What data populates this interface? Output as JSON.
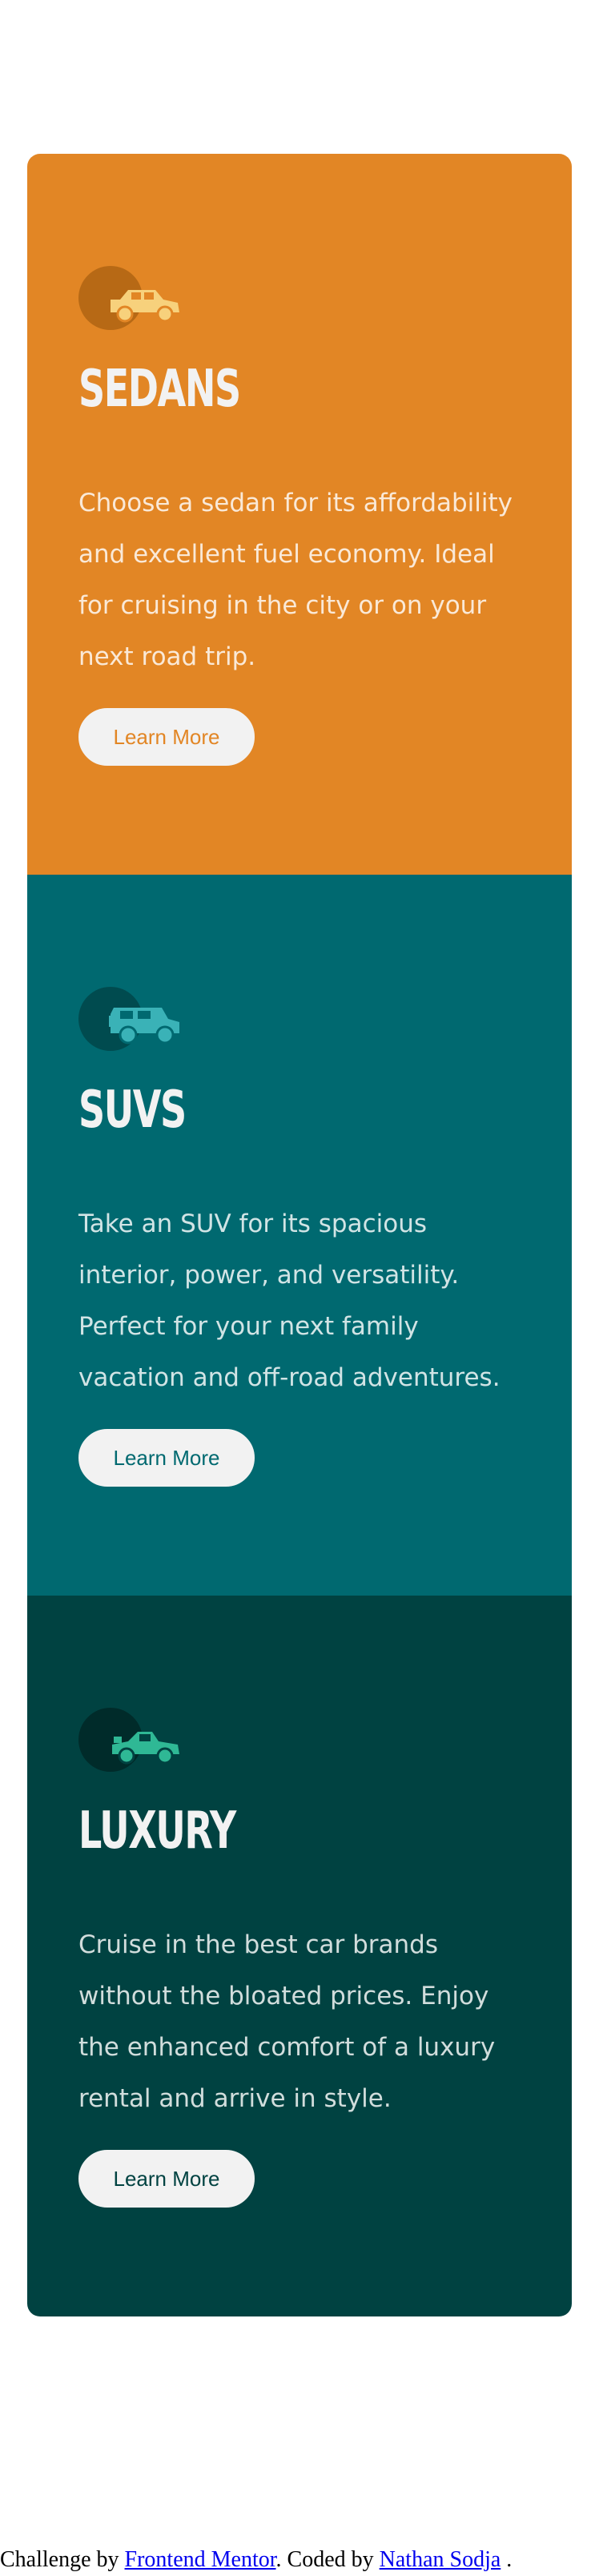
{
  "cards": [
    {
      "title": "SEDANS",
      "description": "Choose a sedan for its affordability and excellent fuel economy. Ideal for cruising in the city or on your next road trip.",
      "button_label": "Learn More",
      "icon": "sedan-icon",
      "color": "#e28625"
    },
    {
      "title": "SUVS",
      "description": "Take an SUV for its spacious interior, power, and versatility. Perfect for your next family vacation and off-road adventures.",
      "button_label": "Learn More",
      "icon": "suv-icon",
      "color": "#006970"
    },
    {
      "title": "LUXURY",
      "description": "Cruise in the best car brands without the bloated prices. Enjoy the enhanced comfort of a luxury rental and arrive in style.",
      "button_label": "Learn More",
      "icon": "luxury-car-icon",
      "color": "#004241"
    }
  ],
  "attribution": {
    "prefix": "Challenge by ",
    "link1": "Frontend Mentor",
    "middle": ". Coded by ",
    "link2": "Nathan Sodja",
    "suffix": "."
  },
  "colors": {
    "button_background": "#f2f2f2",
    "heading": "#f2f2f2",
    "page_background": "#ffffff",
    "link": "#0000ee"
  }
}
